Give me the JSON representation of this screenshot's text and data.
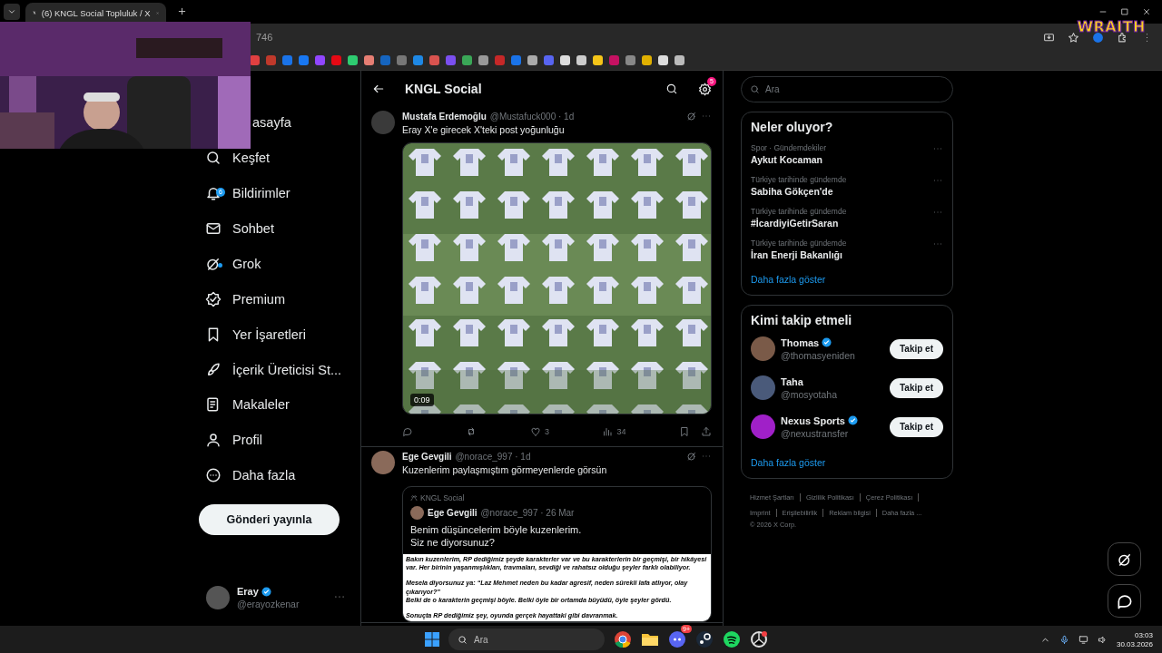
{
  "browser": {
    "tab_title": "(6) KNGL Social Topluluk / X",
    "address": "746"
  },
  "stream_overlay": {
    "logo": "WRAITH"
  },
  "sidebar": {
    "nav": [
      {
        "label": "asayfa",
        "dot": false
      },
      {
        "label": "Keşfet",
        "dot": false
      },
      {
        "label": "Bildirimler",
        "badge": "6",
        "dot": false
      },
      {
        "label": "Sohbet",
        "dot": false
      },
      {
        "label": "Grok",
        "dot": true
      },
      {
        "label": "Premium",
        "dot": false
      },
      {
        "label": "Yer İşaretleri",
        "dot": false
      },
      {
        "label": "İçerik Üreticisi St...",
        "dot": false
      },
      {
        "label": "Makaleler",
        "dot": false
      },
      {
        "label": "Profil",
        "dot": false
      },
      {
        "label": "Daha fazla",
        "dot": false
      }
    ],
    "post_button": "Gönderi yayınla",
    "account": {
      "name": "Eray",
      "verified": true,
      "handle": "@erayozkenar"
    }
  },
  "main": {
    "header": {
      "title": "KNGL Social",
      "settings_badge": "5"
    },
    "posts": [
      {
        "author": "Mustafa Erdemoğlu",
        "meta": "@Mustafuck000 · 1d",
        "text": "Eray X'e girecek X'teki post yoğunluğu",
        "media": {
          "kind": "video",
          "duration": "0:09"
        },
        "actions": {
          "likes": "3",
          "views": "34"
        }
      },
      {
        "author": "Ege Gevgili",
        "meta": "@norace_997 · 1d",
        "text": "Kuzenlerim paylaşmıştım görmeyenlerde görsün",
        "quote": {
          "community": "KNGL Social",
          "author": "Ege Gevgili",
          "meta": "@norace_997 · 26 Mar",
          "text": "Benim düşüncelerim böyle kuzenlerim.\nSiz ne diyorsunuz?",
          "document": [
            [
              "Bakın kuzenlerim, RP dediğimiz şeyde karakterler var ve bu karakterlerin bir geçmişi, bir hikâyesi var. Her birinin yaşanmışlıkları, travmaları, sevdiği ve rahatsız olduğu şeyler farklı olabiliyor."
            ],
            [
              "Mesela diyorsunuz ya: “Laz Mehmet neden bu kadar agresif, neden sürekli lafa atlıyor, olay çıkarıyor?”",
              "Belki de o karakterin geçmişi böyle. Belki öyle bir ortamda büyüdü, öyle şeyler gördü."
            ],
            [
              "Sonuçta RP dediğimiz şey, oyunda gerçek hayattaki gibi davranmak."
            ]
          ]
        }
      }
    ]
  },
  "right": {
    "search": {
      "placeholder": "Ara"
    },
    "trends": {
      "title": "Neler oluyor?",
      "items": [
        {
          "context": "Spor · Gündemdekiler",
          "topic": "Aykut Kocaman"
        },
        {
          "context": "Türkiye tarihinde gündemde",
          "topic": "Sabiha Gökçen'de"
        },
        {
          "context": "Türkiye tarihinde gündemde",
          "topic": "#İcardiyiGetirSaran"
        },
        {
          "context": "Türkiye tarihinde gündemde",
          "topic": "İran Enerji Bakanlığı"
        }
      ],
      "more": "Daha fazla göster"
    },
    "follow": {
      "title": "Kimi takip etmeli",
      "users": [
        {
          "name": "Thomas",
          "verified": true,
          "handle": "@thomasyeniden",
          "button": "Takip et",
          "color": "#7a5a48"
        },
        {
          "name": "Taha",
          "verified": false,
          "handle": "@mosyotaha",
          "button": "Takip et",
          "color": "#4a5a7a"
        },
        {
          "name": "Nexus Sports",
          "verified": true,
          "handle": "@nexustransfer",
          "button": "Takip et",
          "color": "#a020c8"
        }
      ],
      "more": "Daha fazla göster"
    },
    "footer": {
      "links": [
        "Hizmet Şartları",
        "Gizlilik Politikası",
        "Çerez Politikası",
        "Imprint",
        "Erişilebilirlik",
        "Reklam bilgisi",
        "Daha fazla ..."
      ],
      "copyright": "© 2026 X Corp."
    }
  },
  "taskbar": {
    "search": {
      "placeholder": "Ara"
    },
    "app_badge": "9+",
    "time": "03:03",
    "date": "30.03.2026"
  }
}
